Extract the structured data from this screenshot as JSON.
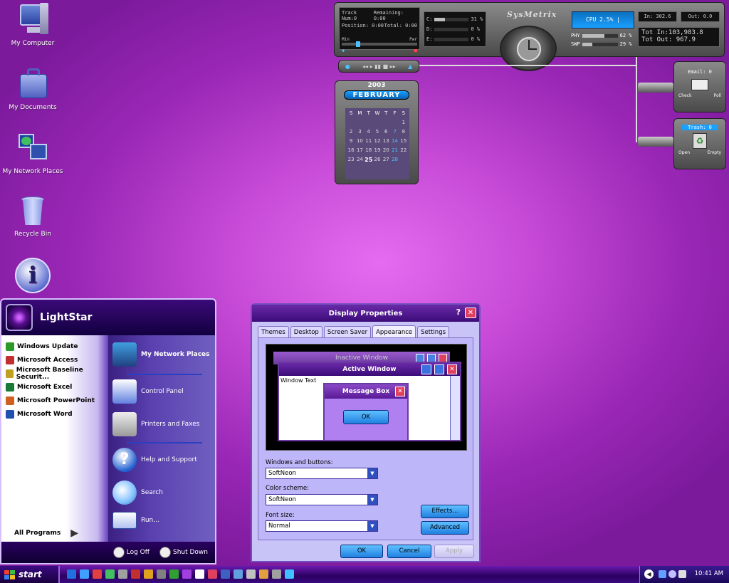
{
  "desktop": {
    "icons": [
      {
        "label": "My Computer"
      },
      {
        "label": "My Documents"
      },
      {
        "label": "My Network Places"
      },
      {
        "label": "Recycle Bin"
      },
      {
        "label": ""
      }
    ]
  },
  "sysmetrix": {
    "track_num_label": "Track Num:",
    "track_num": "0",
    "remaining_label": "Remaining:",
    "remaining": "0:00",
    "position_label": "Position:",
    "position": "0:00",
    "total_label": "Total:",
    "total": "0:00",
    "min_label": "Min",
    "pwr_label": "Pwr",
    "drives": [
      {
        "label": "C:",
        "value": "31 %",
        "fill": 0.31
      },
      {
        "label": "D:",
        "value": "0 %",
        "fill": 0
      },
      {
        "label": "E:",
        "value": "0 %",
        "fill": 0
      }
    ],
    "brand": "SysMetrix",
    "cpu": "CPU 2.5% |",
    "phy_label": "PHY",
    "phy_value": "62 %",
    "phy_fill": 0.62,
    "swp_label": "SWP",
    "swp_value": "29 %",
    "swp_fill": 0.29,
    "in_rate": "In: 302.6",
    "out_rate": "Out: 0.0",
    "tot_in": "Tot In:103,983.8",
    "tot_out": "Tot Out: 967.9",
    "email_label": "Email: 0",
    "check_label": "Check",
    "poll_label": "Poll",
    "trash_label": "Trash: 0",
    "open_label": "Open",
    "empty_label": "Empty"
  },
  "calendar": {
    "year": "2003",
    "month": "FEBRUARY",
    "weekdays": [
      "S",
      "M",
      "T",
      "W",
      "T",
      "F",
      "S"
    ],
    "weeks": [
      [
        "",
        "",
        "",
        "",
        "",
        "",
        "1"
      ],
      [
        "2",
        "3",
        "4",
        "5",
        "6",
        "7",
        "8"
      ],
      [
        "9",
        "10",
        "11",
        "12",
        "13",
        "14",
        "15"
      ],
      [
        "16",
        "17",
        "18",
        "19",
        "20",
        "21",
        "22"
      ],
      [
        "23",
        "24",
        "25",
        "26",
        "27",
        "28",
        ""
      ]
    ],
    "today": "25"
  },
  "start_menu": {
    "user": "LightStar",
    "left_items": [
      {
        "label": "Windows Update",
        "color": "#2b9a2b"
      },
      {
        "label": "Microsoft Access",
        "color": "#c03030"
      },
      {
        "label": "Microsoft Baseline Securit...",
        "color": "#c0a020"
      },
      {
        "label": "Microsoft Excel",
        "color": "#1a7a3a"
      },
      {
        "label": "Microsoft PowerPoint",
        "color": "#d06020"
      },
      {
        "label": "Microsoft Word",
        "color": "#2050b0"
      }
    ],
    "all_programs": "All Programs",
    "right_items": [
      {
        "label": "My Network Places",
        "color": "#40a0e0"
      },
      {
        "label": "Control Panel",
        "color": "#6080e0"
      },
      {
        "label": "Printers and Faxes",
        "color": "#d0d0d0"
      },
      {
        "label": "Help and Support",
        "color": "#2060d0"
      },
      {
        "label": "Search",
        "color": "#80c0ff"
      },
      {
        "label": "Run...",
        "color": "#3050a0"
      }
    ],
    "log_off": "Log Off",
    "shut_down": "Shut Down"
  },
  "dialog": {
    "title": "Display Properties",
    "tabs": [
      "Themes",
      "Desktop",
      "Screen Saver",
      "Appearance",
      "Settings"
    ],
    "active_tab": "Appearance",
    "preview": {
      "inactive": "Inactive Window",
      "active": "Active Window",
      "window_text": "Window Text",
      "message_box": "Message Box",
      "ok": "OK"
    },
    "windows_buttons_label": "Windows and buttons:",
    "windows_buttons_value": "SoftNeon",
    "color_scheme_label": "Color scheme:",
    "color_scheme_value": "SoftNeon",
    "font_size_label": "Font size:",
    "font_size_value": "Normal",
    "effects": "Effects...",
    "advanced": "Advanced",
    "ok": "OK",
    "cancel": "Cancel",
    "apply": "Apply"
  },
  "taskbar": {
    "start": "start",
    "clock": "10:41 AM"
  }
}
